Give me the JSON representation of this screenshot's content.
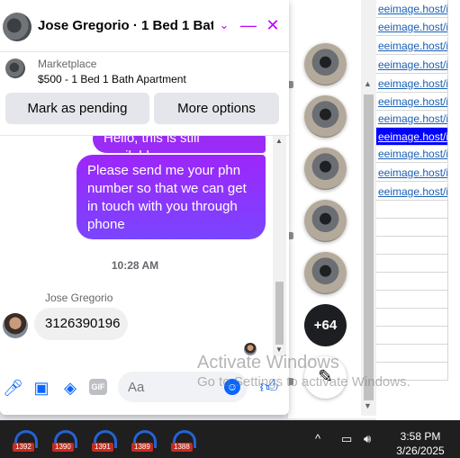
{
  "chat": {
    "title": "Jose Gregorio · 1 Bed 1 Bat…",
    "listing_category": "Marketplace",
    "listing_title": "$500 - 1 Bed 1 Bath Apartment",
    "buttons": {
      "mark_pending": "Mark as pending",
      "more_options": "More options"
    },
    "messages": {
      "outgoing_top_partial": "Hello, this is still available",
      "outgoing_main": "Please send me your phn number so that we can get in touch with you through phone",
      "timestamp": "10:28 AM",
      "sender_name": "Jose Gregorio",
      "incoming": "3126390196"
    },
    "composer": {
      "placeholder": "Aa",
      "gif_label": "GIF"
    }
  },
  "chat_heads": {
    "more_count": "+64"
  },
  "background_page": {
    "link_text": "eeimage.host/i/"
  },
  "watermark": {
    "line1": "Activate Windows",
    "line2": "Go to Settings to activate Windows."
  },
  "taskbar": {
    "badges": [
      "1392",
      "1390",
      "1391",
      "1389",
      "1388"
    ],
    "time": "3:58 PM",
    "date": "3/26/2025"
  },
  "colors": {
    "accent": "#bc00ff",
    "messenger_blue": "#0866ff",
    "bubble_gradient_top": "#9d26fb",
    "bubble_gradient_bottom": "#7a45ff"
  }
}
